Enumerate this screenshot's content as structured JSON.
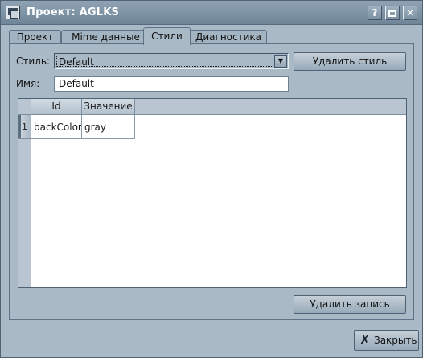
{
  "window": {
    "title": "Проект: AGLKS",
    "buttons": {
      "help": "?",
      "close": "✕"
    }
  },
  "tabs": [
    {
      "label": "Проект",
      "active": false
    },
    {
      "label": "Mime данные",
      "active": false
    },
    {
      "label": "Стили",
      "active": true
    },
    {
      "label": "Диагностика",
      "active": false
    }
  ],
  "style_form": {
    "style_label": "Стиль:",
    "style_value": "Default",
    "delete_style_label": "Удалить стиль",
    "name_label": "Имя:",
    "name_value": "Default"
  },
  "table": {
    "columns": [
      "Id",
      "Значение"
    ],
    "rows": [
      {
        "index": "1",
        "id": "backColor",
        "value": "gray"
      }
    ]
  },
  "delete_record_label": "Удалить запись",
  "close_label": "Закрыть",
  "colors": {
    "window_bg": "#a9b9c6",
    "titlebar": "#7b90a2",
    "title_text": "#ffffff"
  },
  "icons": {
    "app": "app-window-icon",
    "help": "question-icon",
    "maximize": "maximize-icon",
    "close": "close-icon",
    "combo_arrow": "chevron-down-icon",
    "close_button": "close-x-icon"
  }
}
